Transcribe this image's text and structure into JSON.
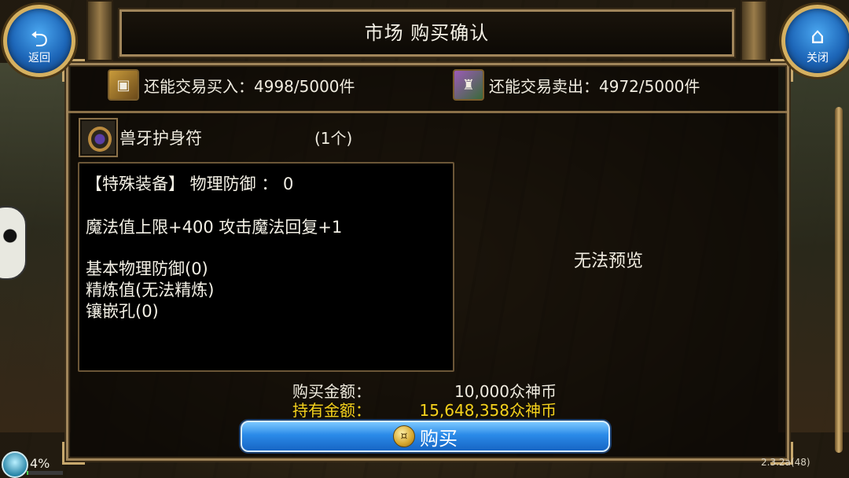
{
  "header": {
    "title": "市场 购买确认",
    "back_label": "返回",
    "back_icon": "back-arrow-icon",
    "close_label": "关闭",
    "close_icon": "home-icon"
  },
  "limits": {
    "buy_text": "还能交易买入：4998/5000件",
    "buy_icon": "treasure-chest-icon",
    "sell_text": "还能交易卖出：4972/5000件",
    "sell_icon": "merchant-icon"
  },
  "item": {
    "icon": "ring-icon",
    "name": "兽牙护身符",
    "quantity": "(1个)"
  },
  "description": {
    "line1": "【特殊装备】 物理防御 ： 0",
    "line2": "魔法值上限+400 攻击魔法回复+1",
    "line3": "基本物理防御(0)",
    "line4": "精炼值(无法精炼)",
    "line5": "镶嵌孔(0)"
  },
  "preview_text": "无法预览",
  "amounts": {
    "purchase_label": "购买金额：",
    "purchase_value": "10,000众神币",
    "holding_label": "持有金额：",
    "holding_value": "15,648,358众神币"
  },
  "buy_button": {
    "label": "购买",
    "icon": "coin-icon"
  },
  "status": {
    "percent": "4%",
    "percent_value": 0.04,
    "version": "2.3.2a(48)"
  },
  "colors": {
    "frame": "#a0855a",
    "highlight_amount": "#f5d21c",
    "button_blue": "#2a8ae8"
  }
}
